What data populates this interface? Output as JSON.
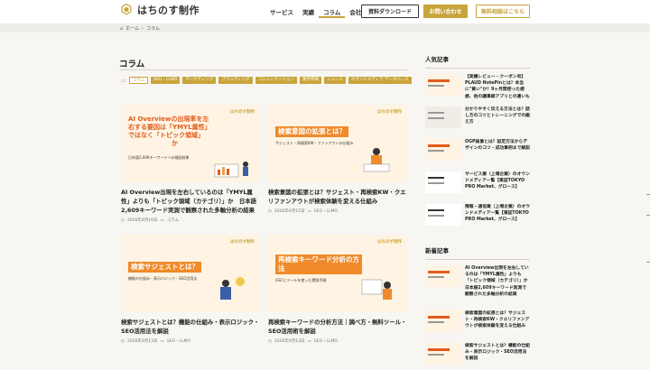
{
  "header": {
    "logo_text": "はちのす制作",
    "nav": [
      {
        "label": "サービス"
      },
      {
        "label": "実績"
      },
      {
        "label": "コラム",
        "active": true
      },
      {
        "label": "会社情報"
      }
    ],
    "download_label": "資料ダウンロード",
    "contact_label": "お問い合わせ",
    "consult_label": "無料相談はこちら"
  },
  "breadcrumb": {
    "home": "ホーム",
    "separator": "›",
    "current": "コラム"
  },
  "page": {
    "title": "コラム",
    "tags": [
      "コラム",
      "SEO・LLMO",
      "マーケティング",
      "ブランディング",
      "コミュニケーション",
      "業界情報",
      "ニュース",
      "オウンドメディア データベース"
    ]
  },
  "cards": [
    {
      "thumb_logo": "はちのす制作",
      "thumb_title_1": "AI Overviewの出現率を左",
      "thumb_title_2": "右する要因は「YMYL属性」",
      "thumb_title_3": "ではなく「トピック領域」",
      "thumb_title_4": "か",
      "thumb_sub": "日本語2,609キーワードへの検証結果",
      "title": "AI Overview出現を左右しているのは「YMYL属性」よりも「トピック領域（カテゴリ）」か　日本語2,609キーワード実測で観察された多軸分析の結果",
      "date": "2026年4月16日",
      "category": "コラム"
    },
    {
      "thumb_logo": "はちのす制作",
      "thumb_title_1": "検索意図の拡張とは？",
      "thumb_sub": "サジェスト・再検索KW・ファンアウトの仕組み",
      "title": "検索意図の拡張とは？サジェスト・再検索KW・クエリファンアウトが検索体験を変える仕組み",
      "date": "2026年4月15日",
      "category": "SEO・LLMO"
    },
    {
      "thumb_logo": "はちのす制作",
      "thumb_title_1": "検索サジェストとは？",
      "thumb_sub": "機能の仕組み・表示ロジック・SEO活用法",
      "title": "検索サジェストとは？機能の仕組み・表示ロジック・SEO活用法を解説",
      "date": "2026年4月13日",
      "category": "SEO・LLMO"
    },
    {
      "thumb_logo": "はちのす制作",
      "thumb_title_1": "再検索キーワード分析の方",
      "thumb_title_2": "法",
      "thumb_sub": "GSCとツールを使った実践手順",
      "title": "再検索キーワードの分析方法｜調べ方・無料ツール・SEO活用術を解説",
      "date": "2026年4月13日",
      "category": "SEO・LLMO"
    }
  ],
  "sidebar": {
    "popular_title": "人気記事",
    "popular": [
      "【実機レビュー・クーポン有】PLAUD NotePinとは？本当に\"買い\"か？9ヶ月間使った感想、他の議事録アプリとの違いも解説",
      "分かりやすく伝える方法とは？話し方のコツとトレーニングでの鍛え方",
      "OGP画像とは？設定方法からデザインのコツ・成功事例まで解説",
      "サービス業（上場企業）のオウンドメディア一覧【東証TOKYO PRO Market、グロース】",
      "情報・通信業（上場企業）のオウンドメディア一覧【東証TOKYO PRO Market、グロース】"
    ],
    "new_title": "新着記事",
    "new": [
      "AI Overview出現を左右しているのは「YMYL属性」よりも「トピック領域（カテゴリ）」か　日本語2,609キーワード実測で観察された多軸分析の結果",
      "検索意図の拡張とは？サジェスト・再検索KW・クエリファンアウトが検索体験を変える仕組み",
      "検索サジェストとは？機能の仕組み・表示ロジック・SEO活用法を解説"
    ]
  },
  "colors": {
    "accent": "#c8a43a",
    "orange": "#e25b1c",
    "thumb_bg": "#fff4e3"
  }
}
